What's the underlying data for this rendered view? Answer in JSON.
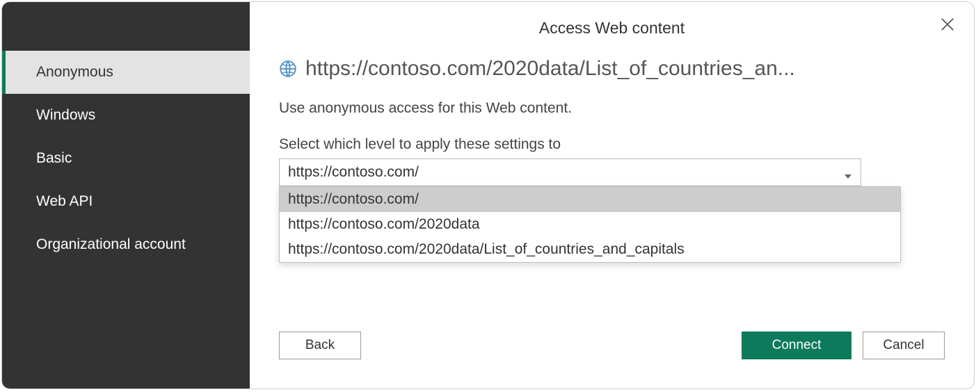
{
  "dialog": {
    "title": "Access Web content",
    "url_display": "https://contoso.com/2020data/List_of_countries_an...",
    "instruction": "Use anonymous access for this Web content.",
    "select_label": "Select which level to apply these settings to",
    "select_value": "https://contoso.com/",
    "dropdown_options": [
      "https://contoso.com/",
      "https://contoso.com/2020data",
      "https://contoso.com/2020data/List_of_countries_and_capitals"
    ],
    "buttons": {
      "back": "Back",
      "connect": "Connect",
      "cancel": "Cancel"
    }
  },
  "sidebar": {
    "items": [
      {
        "label": "Anonymous",
        "active": true
      },
      {
        "label": "Windows",
        "active": false
      },
      {
        "label": "Basic",
        "active": false
      },
      {
        "label": "Web API",
        "active": false
      },
      {
        "label": "Organizational account",
        "active": false
      }
    ]
  }
}
